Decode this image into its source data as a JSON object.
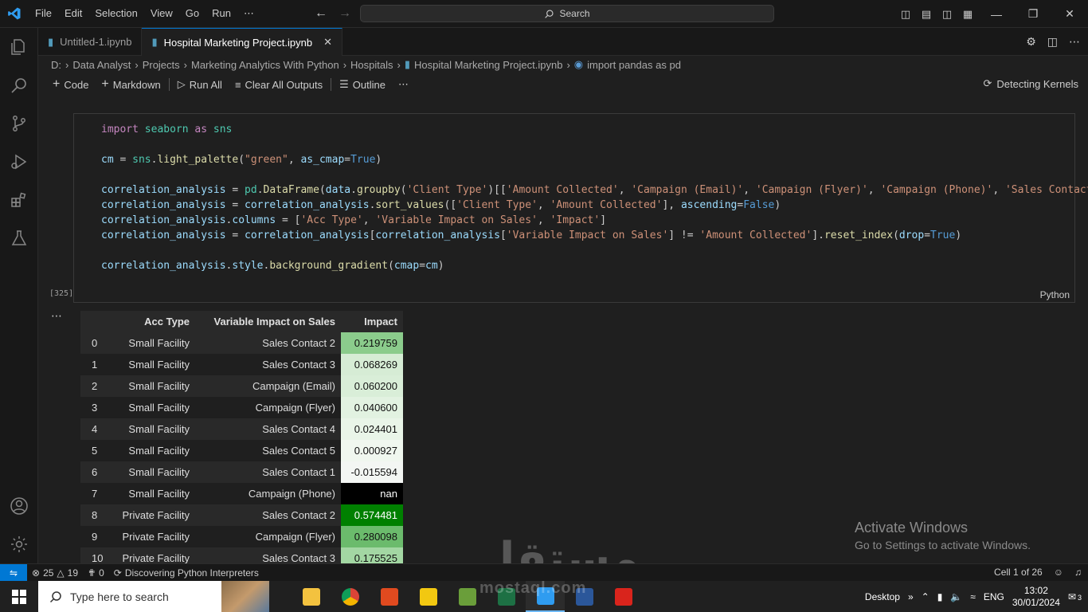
{
  "menu": [
    "File",
    "Edit",
    "Selection",
    "View",
    "Go",
    "Run",
    "⋯"
  ],
  "search": {
    "label": "Search"
  },
  "tabs": [
    {
      "label": "Untitled-1.ipynb",
      "active": false
    },
    {
      "label": "Hospital Marketing Project.ipynb",
      "active": true
    }
  ],
  "breadcrumb": [
    "D:",
    "Data Analyst",
    "Projects",
    "Marketing Analytics With Python",
    "Hospitals",
    "Hospital Marketing Project.ipynb",
    "import pandas as pd"
  ],
  "toolbar": {
    "code": "Code",
    "markdown": "Markdown",
    "run_all": "Run All",
    "clear_outputs": "Clear All Outputs",
    "outline": "Outline",
    "more": "⋯",
    "kernel": "Detecting Kernels"
  },
  "cell": {
    "exec_count": "[325]",
    "language": "Python"
  },
  "dataframe": {
    "columns": [
      "",
      "Acc Type",
      "Variable Impact on Sales",
      "Impact"
    ],
    "rows": [
      {
        "idx": "0",
        "acc": "Small Facility",
        "var": "Sales Contact 2",
        "impact": "0.219759",
        "bg": "#8bcc8c"
      },
      {
        "idx": "1",
        "acc": "Small Facility",
        "var": "Sales Contact 3",
        "impact": "0.068269",
        "bg": "#d6ecd5"
      },
      {
        "idx": "2",
        "acc": "Small Facility",
        "var": "Campaign (Email)",
        "impact": "0.060200",
        "bg": "#d9eed8"
      },
      {
        "idx": "3",
        "acc": "Small Facility",
        "var": "Campaign (Flyer)",
        "impact": "0.040600",
        "bg": "#e2f2e1"
      },
      {
        "idx": "4",
        "acc": "Small Facility",
        "var": "Sales Contact 4",
        "impact": "0.024401",
        "bg": "#e9f5e8"
      },
      {
        "idx": "5",
        "acc": "Small Facility",
        "var": "Sales Contact 5",
        "impact": "0.000927",
        "bg": "#f0f7ef"
      },
      {
        "idx": "6",
        "acc": "Small Facility",
        "var": "Sales Contact 1",
        "impact": "-0.015594",
        "bg": "#f3f6f3"
      },
      {
        "idx": "7",
        "acc": "Small Facility",
        "var": "Campaign (Phone)",
        "impact": "nan",
        "bg": "#000000"
      },
      {
        "idx": "8",
        "acc": "Private Facility",
        "var": "Sales Contact 2",
        "impact": "0.574481",
        "bg": "#008000"
      },
      {
        "idx": "9",
        "acc": "Private Facility",
        "var": "Campaign (Flyer)",
        "impact": "0.280098",
        "bg": "#6bbb6c"
      },
      {
        "idx": "10",
        "acc": "Private Facility",
        "var": "Sales Contact 3",
        "impact": "0.175525",
        "bg": "#a3d7a3"
      }
    ]
  },
  "watermark": {
    "line1": "Activate Windows",
    "line2": "Go to Settings to activate Windows."
  },
  "status": {
    "errors": "25",
    "warnings": "19",
    "ports": "0",
    "discovering": "Discovering Python Interpreters",
    "cell_pos": "Cell 1 of 26"
  },
  "taskbar": {
    "search_placeholder": "Type here to search",
    "desktop": "Desktop",
    "lang": "ENG",
    "time": "13:02",
    "date": "30/01/2024",
    "notifications": "3"
  },
  "overlay": {
    "mostaql_ar": "مستقل",
    "mostaql_en": "mostaql.com"
  },
  "colors": {
    "accent": "#0078d4",
    "editor_bg": "#1f1f1f",
    "chrome_bg": "#181818"
  }
}
